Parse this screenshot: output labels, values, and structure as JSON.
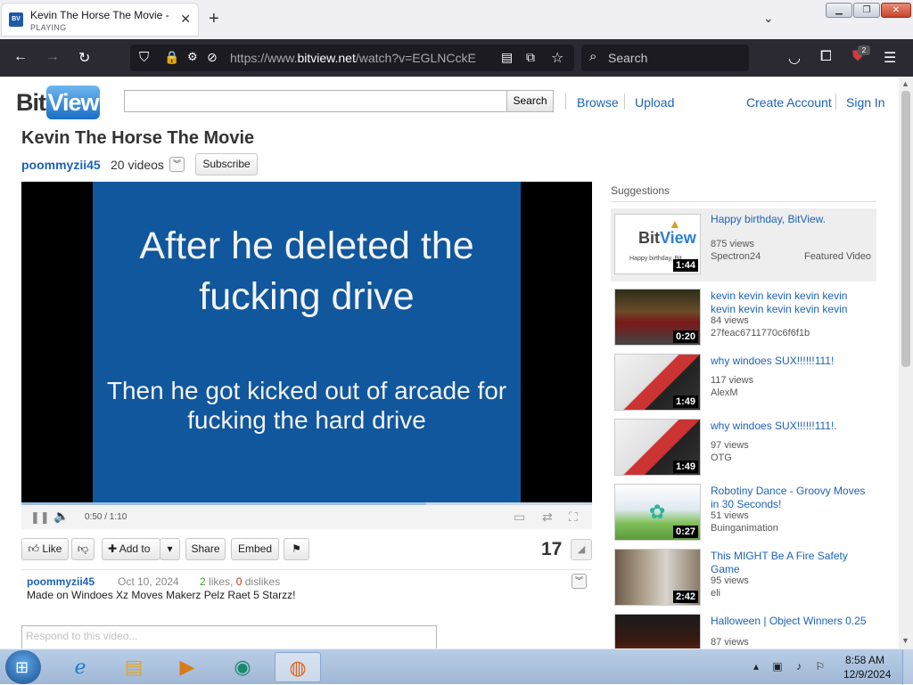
{
  "browser": {
    "tab_title": "Kevin The Horse The Movie - Bi",
    "tab_status": "PLAYING",
    "url_prefix": "https://www.",
    "url_domain": "bitview.net",
    "url_path": "/watch?v=EGLNCckE",
    "search_placeholder": "Search",
    "addon_badge": "2"
  },
  "site": {
    "logo_bit": "Bit",
    "logo_view": "View",
    "search_button": "Search",
    "nav": {
      "browse": "Browse",
      "upload": "Upload",
      "create_account": "Create Account",
      "sign_in": "Sign In"
    }
  },
  "video": {
    "title": "Kevin The Horse The Movie",
    "channel": "poommyzii45",
    "video_count": "20 videos",
    "subscribe_label": "Subscribe",
    "caption_main": "After he deleted the fucking drive",
    "caption_sub": "Then he got kicked out of arcade for fucking the hard drive",
    "time": "0:50 / 1:10",
    "progress": 0.71,
    "buttons": {
      "like": "Like",
      "add_to": "Add to",
      "share": "Share",
      "embed": "Embed"
    },
    "like_count": "17",
    "info": {
      "channel": "poommyzii45",
      "date": "Oct 10, 2024",
      "likes_num": "2",
      "likes_word": "likes,",
      "dislikes_num": "0",
      "dislikes_word": "dislikes",
      "description": "Made on Windoes Xz Moves Makerz Pelz Raet 5 Starzz!"
    },
    "comment_placeholder": "Respond to this video..."
  },
  "suggestions": {
    "heading": "Suggestions",
    "items": [
      {
        "title": "Happy birthday, BitView.",
        "views": "875 views",
        "user": "Spectron24",
        "duration": "1:44",
        "featured": "Featured Video"
      },
      {
        "title": "kevin kevin kevin kevin kevin kevin kevin kevin kevin kevin",
        "views": "84 views",
        "user": "27feac6711770c6f6f1b",
        "duration": "0:20"
      },
      {
        "title": "why windoes SUX!!!!!!111!",
        "views": "117 views",
        "user": "AlexM",
        "duration": "1:49"
      },
      {
        "title": "why windoes SUX!!!!!!111!.",
        "views": "97 views",
        "user": "OTG",
        "duration": "1:49"
      },
      {
        "title": "Robotiny Dance - Groovy Moves in 30 Seconds!",
        "views": "51 views",
        "user": "Buinganimation",
        "duration": "0:27"
      },
      {
        "title": "This MIGHT Be A Fire Safety Game",
        "views": "95 views",
        "user": "eli",
        "duration": "2:42"
      },
      {
        "title": "Halloween | Object Winners 0.25",
        "views": "87 views",
        "user": "",
        "duration": ""
      }
    ]
  },
  "taskbar": {
    "time": "8:58 AM",
    "date": "12/9/2024"
  }
}
